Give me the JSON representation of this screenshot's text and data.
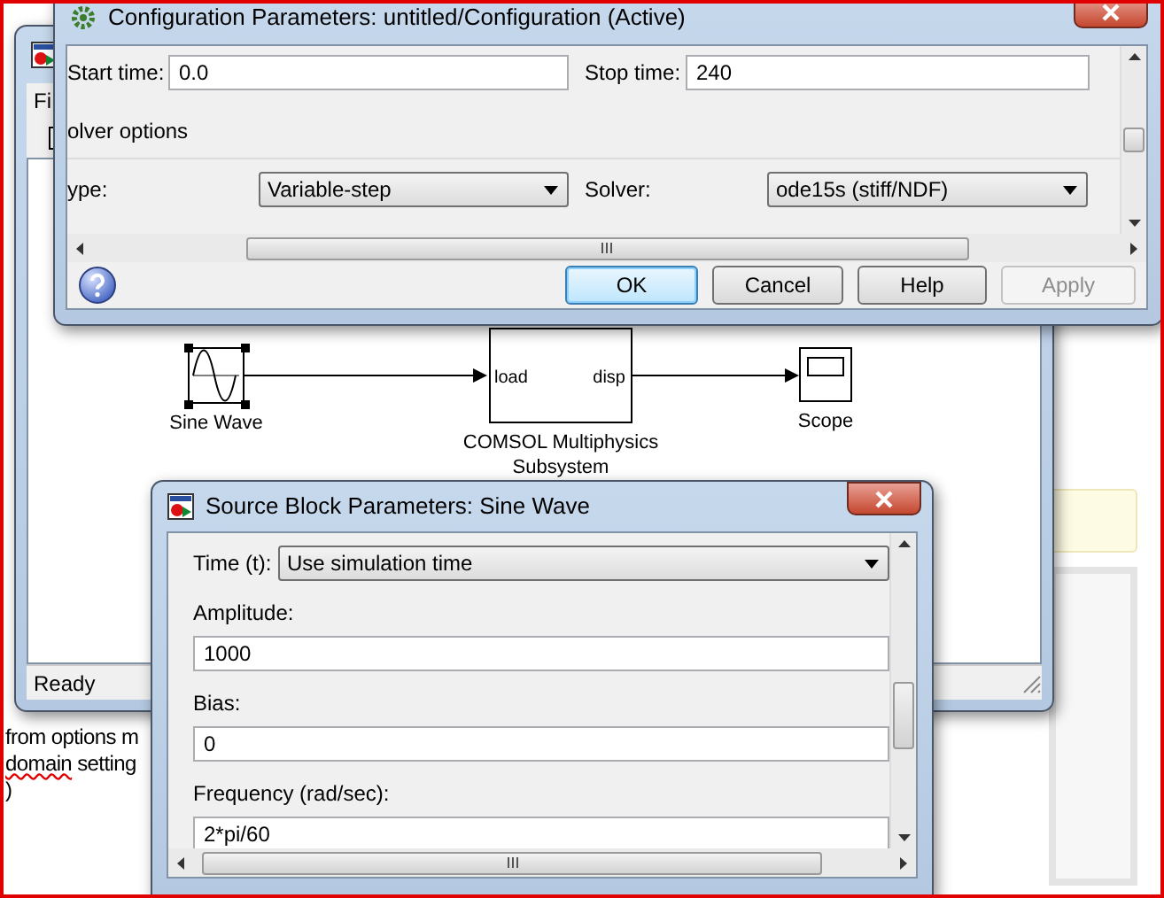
{
  "background_document": {
    "lines": [
      [
        {
          "text": "from options m",
          "misspelled": false
        }
      ],
      [
        {
          "text": "domain",
          "misspelled": true
        },
        {
          "text": " setting",
          "misspelled": false
        }
      ],
      [
        {
          "text": ")",
          "misspelled": false
        }
      ]
    ]
  },
  "model_window": {
    "menu": [
      "Fi"
    ],
    "status": "Ready",
    "blocks": [
      {
        "kind": "sine",
        "label_lines": [
          "Sine Wave"
        ],
        "selected": true
      },
      {
        "kind": "subsystem",
        "label_lines": [
          "COMSOL Multiphysics",
          "Subsystem"
        ],
        "ports": [
          "load",
          "disp"
        ],
        "selected": false
      },
      {
        "kind": "scope",
        "label_lines": [
          "Scope"
        ],
        "selected": false
      }
    ]
  },
  "config_dialog": {
    "title": "Configuration Parameters: untitled/Configuration (Active)",
    "start_time": {
      "label": "Start time:",
      "value": "0.0"
    },
    "stop_time": {
      "label": "Stop time:",
      "value": "240"
    },
    "solver_group": "olver options",
    "type": {
      "label": "ype:",
      "value": "Variable-step"
    },
    "solver": {
      "label": "Solver:",
      "value": "ode15s (stiff/NDF)"
    },
    "buttons": [
      {
        "label": "OK",
        "default": true,
        "disabled": false
      },
      {
        "label": "Cancel",
        "default": false,
        "disabled": false
      },
      {
        "label": "Help",
        "default": false,
        "disabled": false
      },
      {
        "label": "Apply",
        "default": false,
        "disabled": true
      }
    ]
  },
  "sine_dialog": {
    "title": "Source Block Parameters: Sine Wave",
    "time": {
      "label": "Time (t):",
      "value": "Use simulation time"
    },
    "fields": [
      {
        "label": "Amplitude:",
        "value": "1000"
      },
      {
        "label": "Bias:",
        "value": "0"
      },
      {
        "label": "Frequency (rad/sec):",
        "value": "2*pi/60"
      }
    ]
  }
}
